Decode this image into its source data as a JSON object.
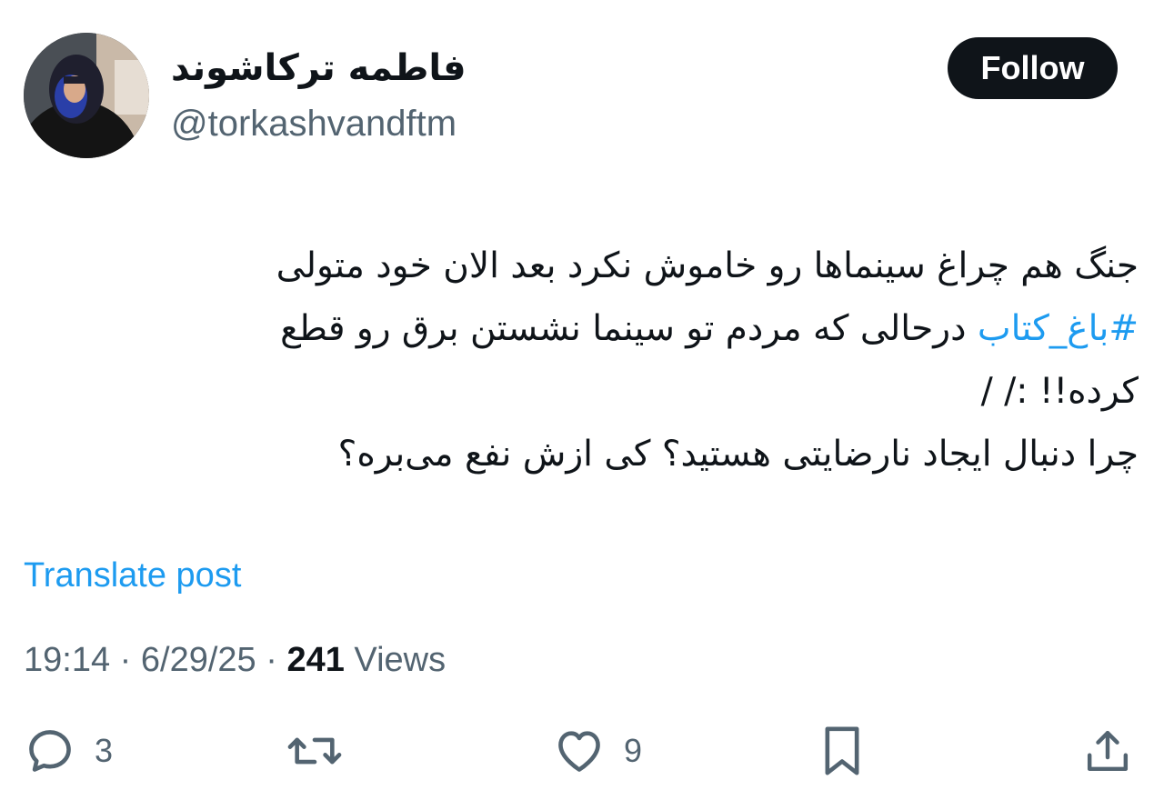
{
  "user": {
    "display_name": "فاطمه ترکاشوند",
    "handle": "@torkashvandftm",
    "follow_label": "Follow"
  },
  "post": {
    "line1": "جنگ هم چراغ سینماها رو خاموش نکرد بعد الان خود متولی",
    "hashtag": "#باغ_کتاب",
    "line2_rest": " درحالی که مردم تو سینما نشستن برق رو قطع",
    "line3": "کرده!! :/ /",
    "line4": "چرا دنبال ایجاد نارضایتی هستید؟ کی ازش نفع می‌بره؟"
  },
  "translate_label": "Translate post",
  "meta": {
    "time": "19:14",
    "sep1": " · ",
    "date": "6/29/25",
    "sep2": " · ",
    "views_count": "241",
    "views_label": " Views"
  },
  "actions": {
    "reply_icon": "reply-icon",
    "reply_count": "3",
    "retweet_icon": "retweet-icon",
    "like_icon": "like-icon",
    "like_count": "9",
    "bookmark_icon": "bookmark-icon",
    "share_icon": "share-icon"
  },
  "colors": {
    "text": "#0f1419",
    "secondary": "#536471",
    "link": "#1d9bf0",
    "button_bg": "#0f1419"
  }
}
